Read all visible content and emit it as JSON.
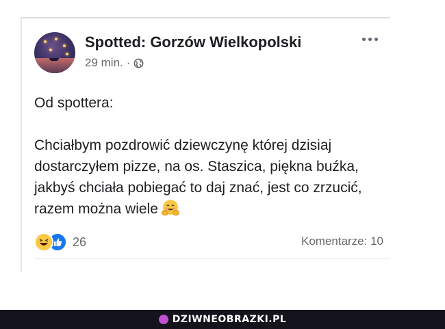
{
  "post": {
    "page_name": "Spotted: Gorzów Wielkopolski",
    "timestamp": "29 min.",
    "separator": "·",
    "privacy_icon": "globe-icon",
    "menu_icon": "more-dots-icon",
    "intro": "Od spottera:",
    "body": "Chciałbym pozdrowić dziewczynę której dzisiaj dostarczyłem pizze, na os. Staszica, piękna buźka, jakbyś chciała pobiegać to daj znać, jest co zrzucić, razem można wiele",
    "emoji": "hugging-face-icon"
  },
  "reactions": {
    "icons": [
      "haha-icon",
      "like-icon"
    ],
    "count": "26"
  },
  "comments": {
    "label": "Komentarze: 10"
  },
  "watermark": {
    "text": "DZIWNEOBRAZKI.PL"
  },
  "colors": {
    "text": "#1c1e21",
    "secondary": "#65676b",
    "like_blue": "#1877f2",
    "haha_yellow": "#f7c948",
    "banner_bg": "#15131c"
  }
}
